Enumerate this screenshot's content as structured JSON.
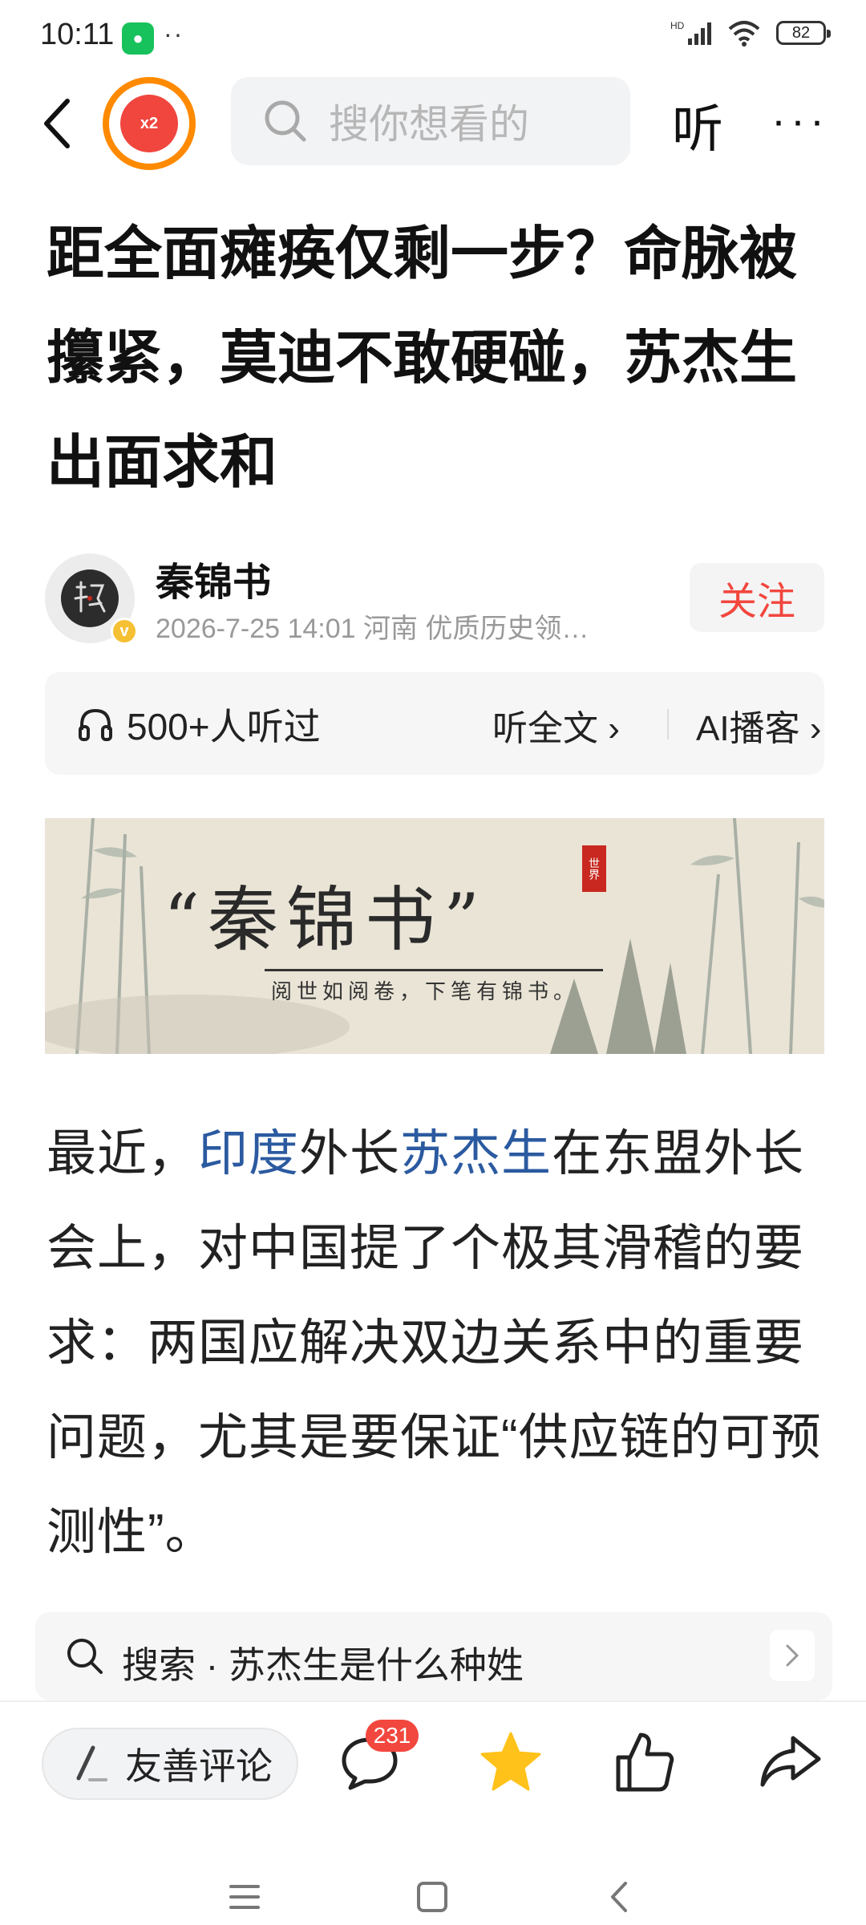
{
  "status_bar": {
    "time": "10:11",
    "network": "HD",
    "battery": "82"
  },
  "top_bar": {
    "badge": "x2",
    "search_placeholder": "搜你想看的",
    "listen_label": "听",
    "more_label": "···"
  },
  "article": {
    "title": "距全面瘫痪仅剩一步？命脉被攥紧，莫迪不敢硬碰，苏杰生出面求和",
    "author": {
      "name": "秦锦书",
      "meta": "2026-7-25  14:01  河南  优质历史领…",
      "follow_label": "关注"
    },
    "listen_card": {
      "count_label": "500+人听过",
      "full_label": "听全文",
      "ai_label": "AI播客"
    },
    "banner": {
      "title": "“秦锦书”",
      "subtitle": "阅世如阅卷，下笔有锦书。",
      "seal": "世界"
    },
    "paragraph": {
      "p1": "最近，",
      "link1": "印度",
      "p2": "外长",
      "link2": "苏杰生",
      "p3": "在东盟外长会上，对中国提了个极其滑稽的要求：两国应解决双边关系中的重要问题，尤其是要保证“供应链的可预测性”。"
    }
  },
  "search_suggestion": {
    "label": "搜索 · 苏杰生是什么种姓"
  },
  "action_bar": {
    "comment_label": "友善评论",
    "comment_count": "231"
  }
}
